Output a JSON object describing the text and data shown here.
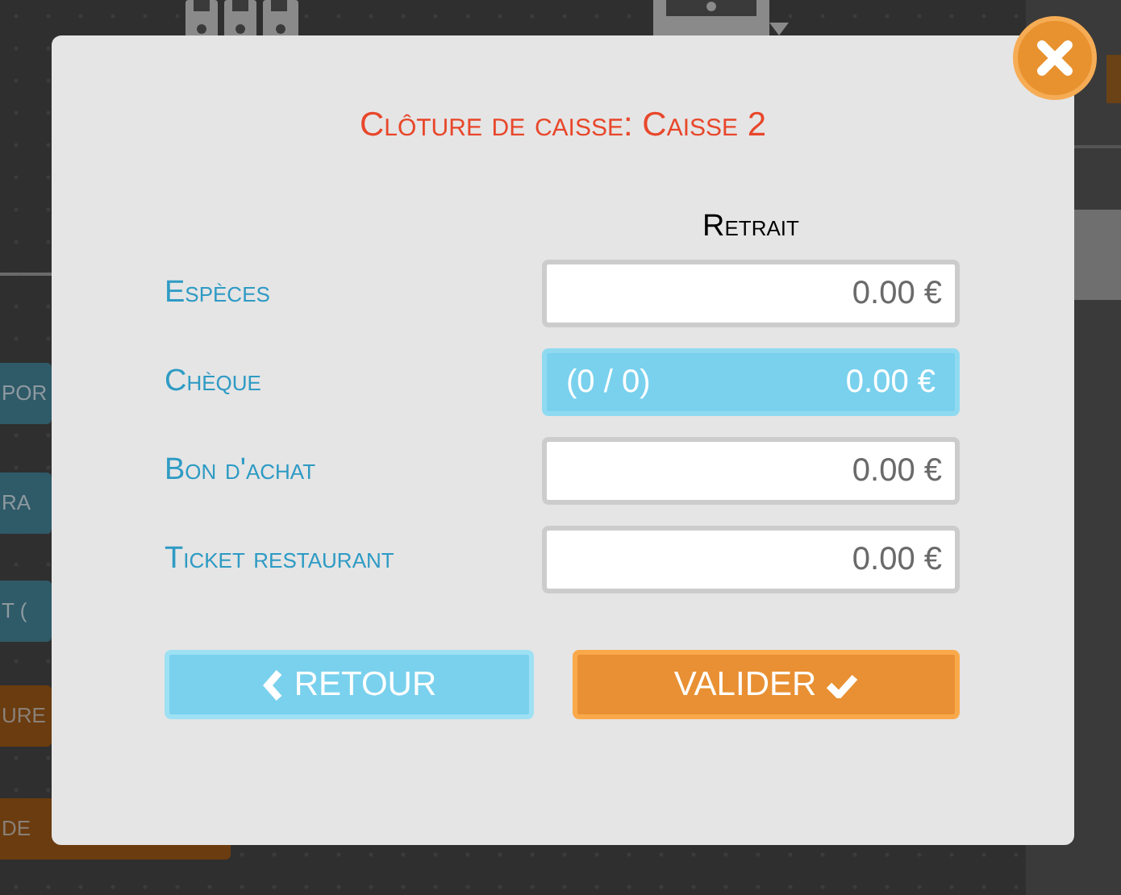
{
  "background_buttons": [
    {
      "label": "POR",
      "kind": "blue"
    },
    {
      "label": "RA",
      "kind": "blue"
    },
    {
      "label": "T (",
      "kind": "blue"
    },
    {
      "label": "URE",
      "kind": "orange"
    },
    {
      "label": "DE",
      "kind": "orange"
    }
  ],
  "dialog": {
    "title": "Clôture de caisse: Caisse 2",
    "column_header": "Retrait",
    "rows": [
      {
        "label": "Espèces",
        "kind": "input",
        "value": "0.00 €"
      },
      {
        "label": "Chèque",
        "kind": "summary",
        "count": "(0 / 0)",
        "value": "0.00 €"
      },
      {
        "label": "Bon d'achat",
        "kind": "input",
        "value": "0.00 €"
      },
      {
        "label": "Ticket restaurant",
        "kind": "input",
        "value": "0.00 €"
      }
    ],
    "buttons": [
      {
        "label": "RETOUR",
        "kind": "back"
      },
      {
        "label": "VALIDER",
        "kind": "confirm"
      }
    ]
  }
}
